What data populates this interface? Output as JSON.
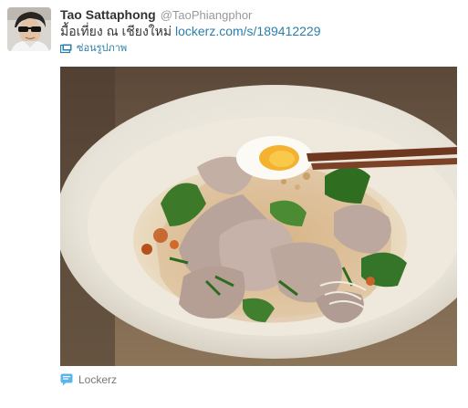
{
  "tweet": {
    "author_name": "Tao Sattaphong",
    "author_handle": "@TaoPhiangphor",
    "text_before_link": "มื้อเที่ยง ณ เชียงใหม่ ",
    "link_text": "lockerz.com/s/189412229",
    "hide_photo_label": "ซ่อนรูปภาพ",
    "media_source_label": "Lockerz"
  },
  "icons": {
    "hide_photo": "photo-icon",
    "source": "lockerz-icon"
  },
  "colors": {
    "link": "#2a7fa8",
    "name": "#333333",
    "handle": "#999999",
    "source_text": "#777777",
    "source_icon": "#5bb5e8"
  }
}
